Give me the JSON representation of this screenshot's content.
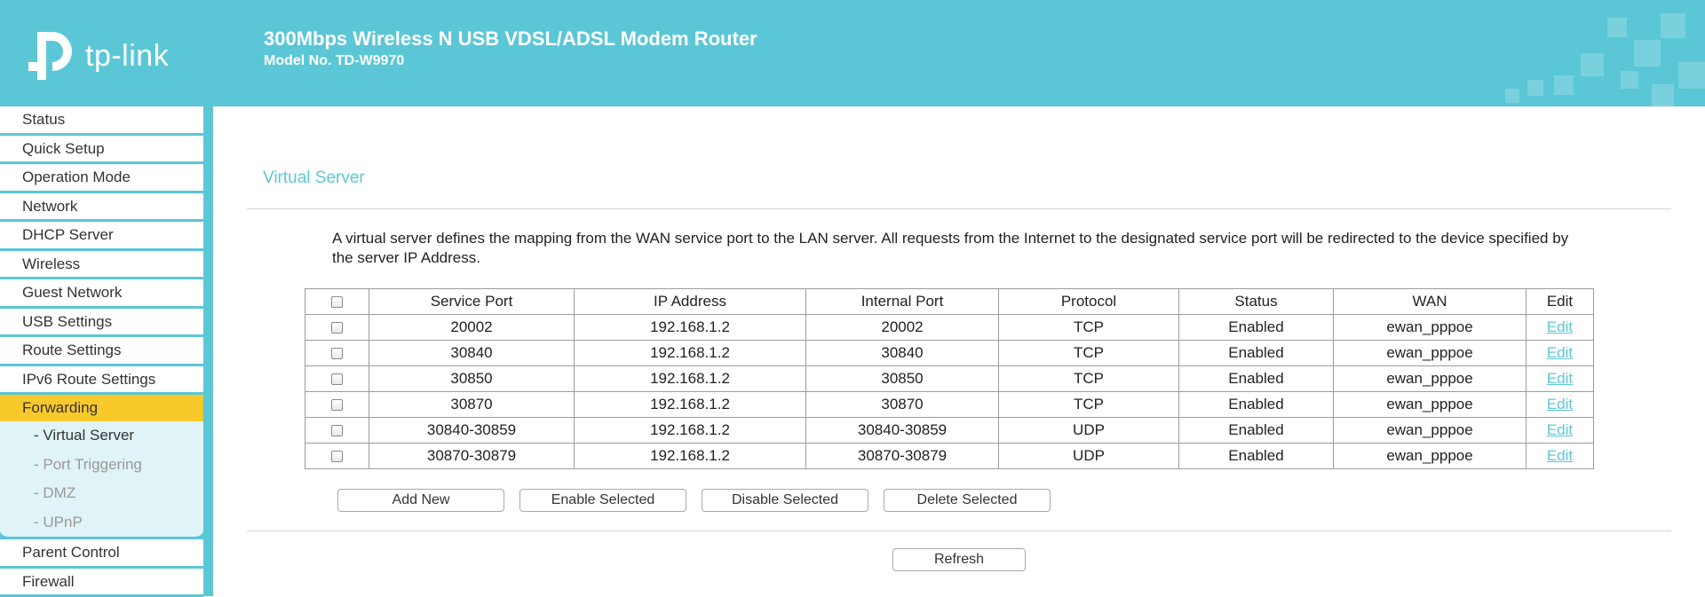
{
  "header": {
    "logo_text": "tp-link",
    "title": "300Mbps Wireless N USB VDSL/ADSL Modem Router",
    "model": "Model No. TD-W9970",
    "accent_color": "#5bc7d6"
  },
  "sidebar": {
    "items_top": [
      {
        "label": "Status"
      },
      {
        "label": "Quick Setup"
      },
      {
        "label": "Operation Mode"
      },
      {
        "label": "Network"
      },
      {
        "label": "DHCP Server"
      },
      {
        "label": "Wireless"
      },
      {
        "label": "Guest Network"
      },
      {
        "label": "USB Settings"
      },
      {
        "label": "Route Settings"
      },
      {
        "label": "IPv6 Route Settings"
      }
    ],
    "active_item": {
      "label": "Forwarding"
    },
    "submenu": [
      {
        "label": "- Virtual Server"
      },
      {
        "label": "- Port Triggering"
      },
      {
        "label": "- DMZ"
      },
      {
        "label": "- UPnP"
      }
    ],
    "items_bottom": [
      {
        "label": "Parent Control"
      },
      {
        "label": "Firewall"
      }
    ],
    "active_color": "#f9c92c"
  },
  "main": {
    "title": "Virtual Server",
    "description": "A virtual server defines the mapping from the WAN service port to the LAN server. All requests from the Internet to the designated service port will be redirected to the device specified by the server IP Address.",
    "table": {
      "headers": [
        "Service Port",
        "IP Address",
        "Internal Port",
        "Protocol",
        "Status",
        "WAN",
        "Edit"
      ],
      "rows": [
        {
          "service_port": "20002",
          "ip": "192.168.1.2",
          "internal_port": "20002",
          "protocol": "TCP",
          "status": "Enabled",
          "wan": "ewan_pppoe",
          "edit": "Edit"
        },
        {
          "service_port": "30840",
          "ip": "192.168.1.2",
          "internal_port": "30840",
          "protocol": "TCP",
          "status": "Enabled",
          "wan": "ewan_pppoe",
          "edit": "Edit"
        },
        {
          "service_port": "30850",
          "ip": "192.168.1.2",
          "internal_port": "30850",
          "protocol": "TCP",
          "status": "Enabled",
          "wan": "ewan_pppoe",
          "edit": "Edit"
        },
        {
          "service_port": "30870",
          "ip": "192.168.1.2",
          "internal_port": "30870",
          "protocol": "TCP",
          "status": "Enabled",
          "wan": "ewan_pppoe",
          "edit": "Edit"
        },
        {
          "service_port": "30840-30859",
          "ip": "192.168.1.2",
          "internal_port": "30840-30859",
          "protocol": "UDP",
          "status": "Enabled",
          "wan": "ewan_pppoe",
          "edit": "Edit"
        },
        {
          "service_port": "30870-30879",
          "ip": "192.168.1.2",
          "internal_port": "30870-30879",
          "protocol": "UDP",
          "status": "Enabled",
          "wan": "ewan_pppoe",
          "edit": "Edit"
        }
      ]
    },
    "buttons": {
      "add_new": "Add New",
      "enable_selected": "Enable Selected",
      "disable_selected": "Disable Selected",
      "delete_selected": "Delete Selected",
      "refresh": "Refresh"
    }
  }
}
